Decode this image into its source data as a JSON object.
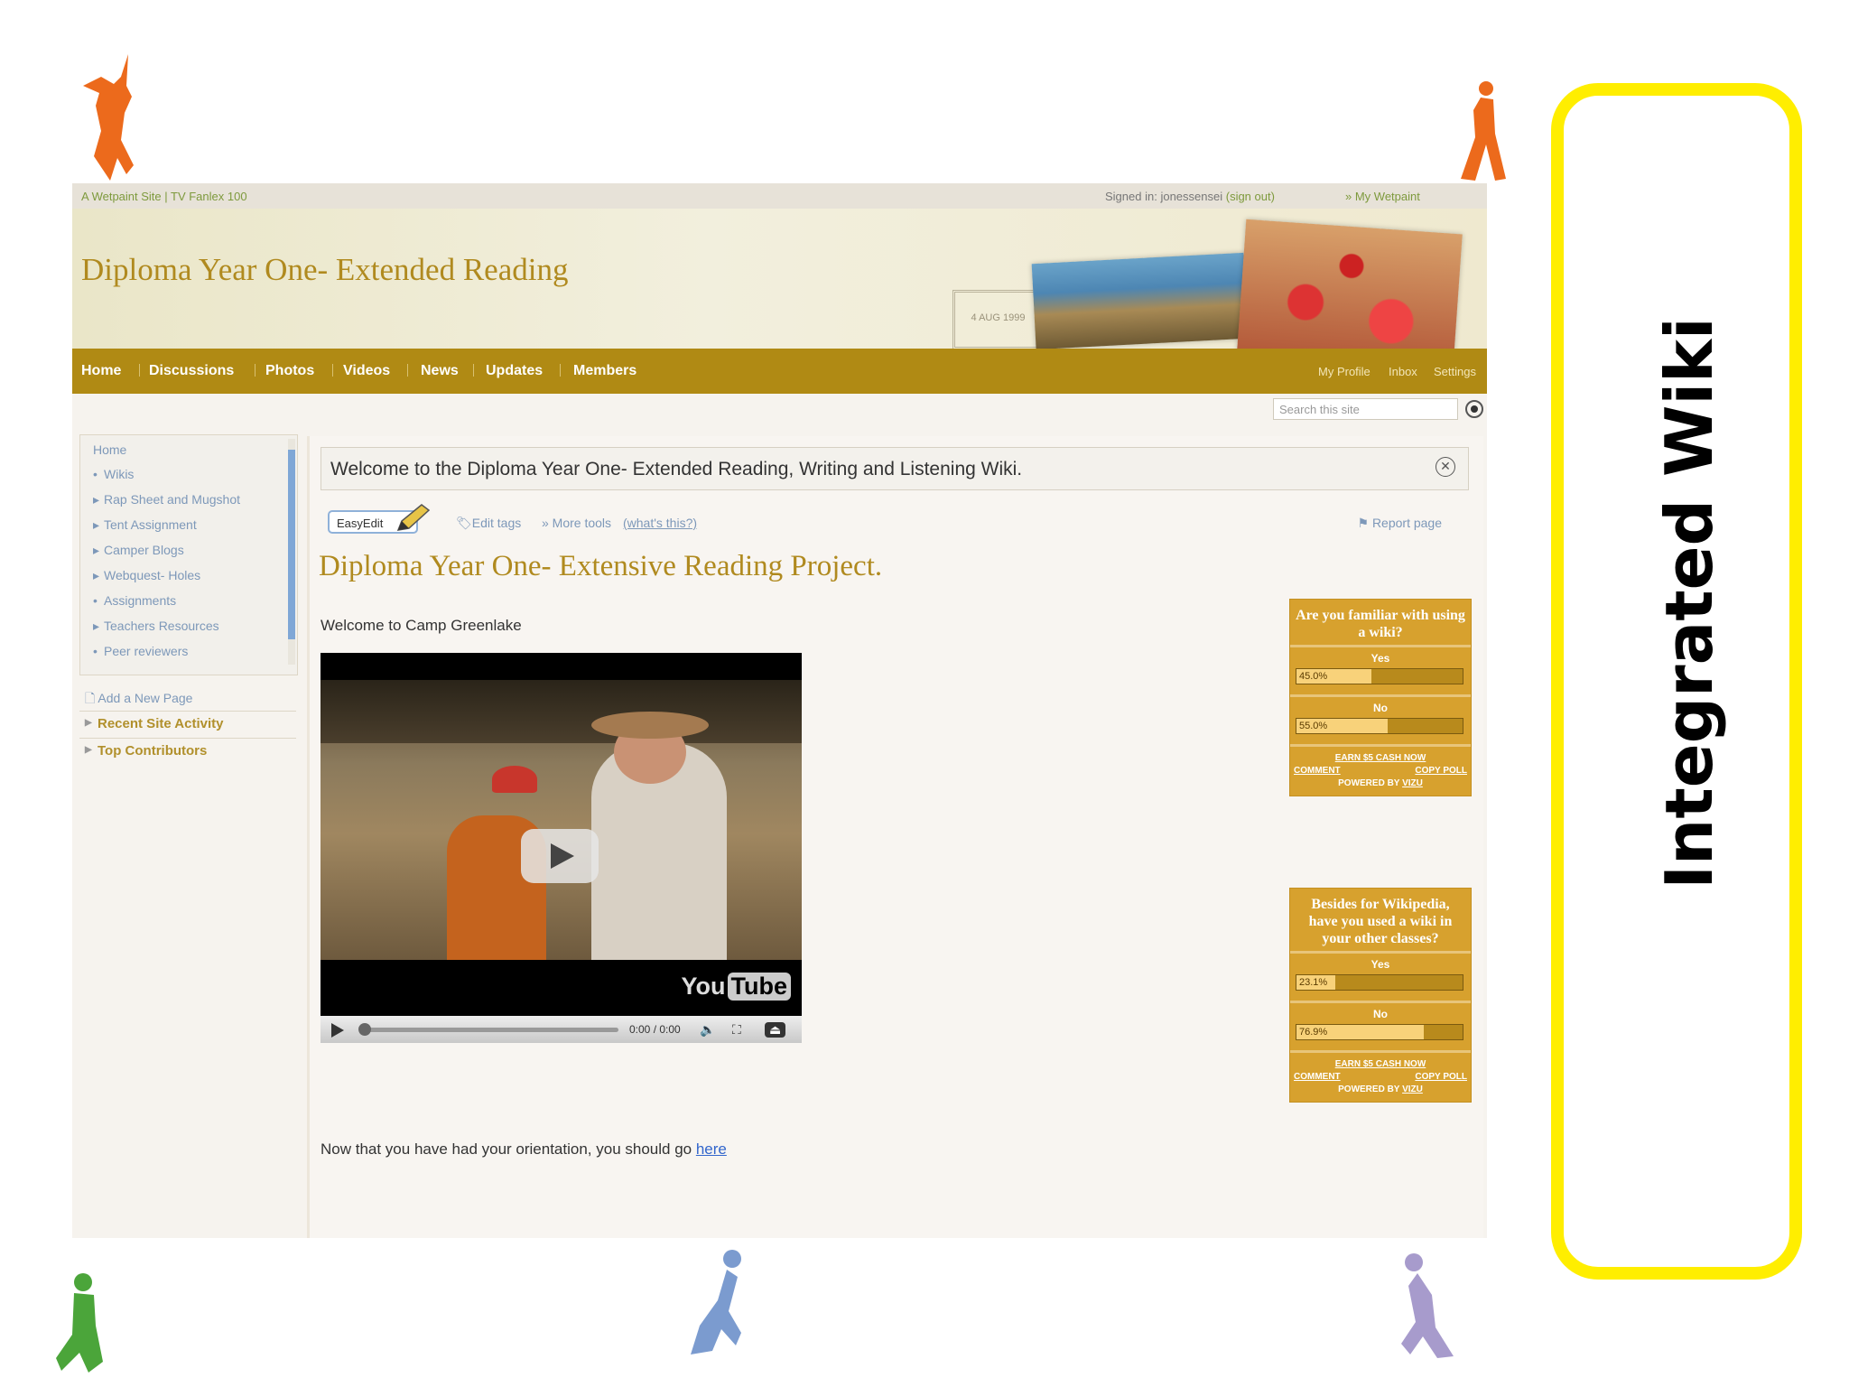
{
  "slide": {
    "side_title": "Integrated Wiki"
  },
  "topbar": {
    "left_text": "A Wetpaint Site | TV Fanlex 100",
    "signed_in_label": "Signed in:",
    "username": "jonessensei",
    "sign_out": "(sign out)",
    "my_wetpaint": "» My Wetpaint"
  },
  "header": {
    "site_title": "Diploma Year One- Extended Reading",
    "stamp_text": "4 AUG 1999"
  },
  "nav": {
    "items": [
      "Home",
      "Discussions",
      "Photos",
      "Videos",
      "News",
      "Updates",
      "Members"
    ],
    "right_items": [
      "My Profile",
      "Inbox",
      "Settings"
    ]
  },
  "search": {
    "placeholder": "Search this site"
  },
  "sidebar": {
    "links": [
      "Home",
      "Wikis",
      "Rap Sheet and Mugshot",
      "Tent Assignment",
      "Camper Blogs",
      "Webquest- Holes",
      "Assignments",
      "Teachers Resources",
      "Peer reviewers"
    ],
    "add_page": "Add a New Page",
    "sections": [
      "Recent Site Activity",
      "Top Contributors"
    ]
  },
  "main": {
    "welcome": "Welcome to the Diploma Year One- Extended Reading, Writing and Listening Wiki.",
    "easyedit": "EasyEdit",
    "edit_tags": "Edit tags",
    "more_tools": "» More tools",
    "whats_this": "(what's this?)",
    "report_page": "Report page",
    "page_title": "Diploma Year One- Extensive Reading Project.",
    "intro": "Welcome to Camp Greenlake",
    "orientation": "Now that you have had your orientation, you should go",
    "orientation_link": "here"
  },
  "video": {
    "brand_you": "You",
    "brand_tube": "Tube",
    "time": "0:00 / 0:00",
    "progress": 0.0
  },
  "polls": [
    {
      "question": "Are you familiar with using a wiki?",
      "options": [
        {
          "label": "Yes",
          "percent_text": "45.0%",
          "value": 0.45
        },
        {
          "label": "No",
          "percent_text": "55.0%",
          "value": 0.55
        }
      ],
      "earn": "EARN $5 CASH NOW",
      "comment": "COMMENT",
      "copy": "COPY POLL",
      "powered_by": "POWERED BY",
      "powered_brand": "VIZU"
    },
    {
      "question": "Besides for Wikipedia, have you used a wiki in your other classes?",
      "options": [
        {
          "label": "Yes",
          "percent_text": "23.1%",
          "value": 0.231
        },
        {
          "label": "No",
          "percent_text": "76.9%",
          "value": 0.769
        }
      ],
      "earn": "EARN $5 CASH NOW",
      "comment": "COMMENT",
      "copy": "COPY POLL",
      "powered_by": "POWERED BY",
      "powered_brand": "VIZU"
    }
  ],
  "colors": {
    "accent_gold": "#b08a14",
    "title_gold": "#b08a1f",
    "link_blue": "#7d98b9",
    "poll_bg": "#d7a12e",
    "highlight_yellow": "#ffee00"
  },
  "icons": [
    "jumping-figure-icon",
    "walking-figure-icon",
    "pencil-icon",
    "tag-icon",
    "flag-icon",
    "close-icon",
    "play-icon",
    "volume-icon",
    "fullscreen-icon",
    "page-icon"
  ]
}
